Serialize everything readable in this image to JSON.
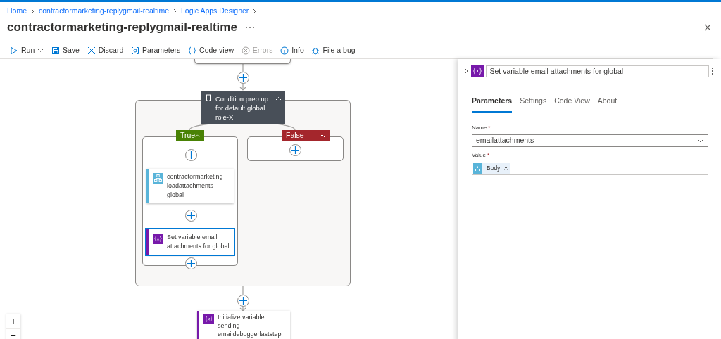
{
  "breadcrumb": [
    "Home",
    "contractormarketing-replygmail-realtime",
    "Logic Apps Designer"
  ],
  "title": "contractormarketing-replygmail-realtime",
  "toolbar": [
    {
      "kind": "run",
      "label": "Run",
      "disabled": false
    },
    {
      "kind": "save",
      "label": "Save",
      "disabled": false
    },
    {
      "kind": "discard",
      "label": "Discard",
      "disabled": false
    },
    {
      "kind": "parameters",
      "label": "Parameters",
      "disabled": false
    },
    {
      "kind": "code",
      "label": "Code view",
      "disabled": false
    },
    {
      "kind": "errors",
      "label": "Errors",
      "disabled": true
    },
    {
      "kind": "info",
      "label": "Info",
      "disabled": false
    },
    {
      "kind": "bug",
      "label": "File a bug",
      "disabled": false
    }
  ],
  "condition": {
    "title": "Condition prep up for default global role-X",
    "expanded": true
  },
  "branches": [
    {
      "label": "True",
      "kind": "true",
      "expanded": true,
      "actions": [
        {
          "title": "contractormarketing-loadattachments global",
          "kind": "workflow",
          "selected": false
        },
        {
          "title": "Set variable email attachments for global",
          "kind": "variable",
          "selected": true
        }
      ]
    },
    {
      "label": "False",
      "kind": "false",
      "expanded": true
    }
  ],
  "after": [
    {
      "title": "Initialize variable sending emaildebuggerlaststep",
      "kind": "variable",
      "selected": false
    }
  ],
  "zoom_controls": [
    "+",
    "−"
  ],
  "panel": {
    "title": "Set variable email attachments for global",
    "tabs": [
      {
        "label": "Parameters",
        "selected": true
      },
      {
        "label": "Settings",
        "selected": false
      },
      {
        "label": "Code View",
        "selected": false
      },
      {
        "label": "About",
        "selected": false
      }
    ],
    "fields": [
      {
        "label": "Name",
        "required": "*",
        "kind": "select",
        "value": "emailattachments"
      },
      {
        "label": "Value",
        "required": "*",
        "kind": "tokens",
        "tokens": [
          {
            "label": "Body"
          }
        ]
      }
    ]
  }
}
